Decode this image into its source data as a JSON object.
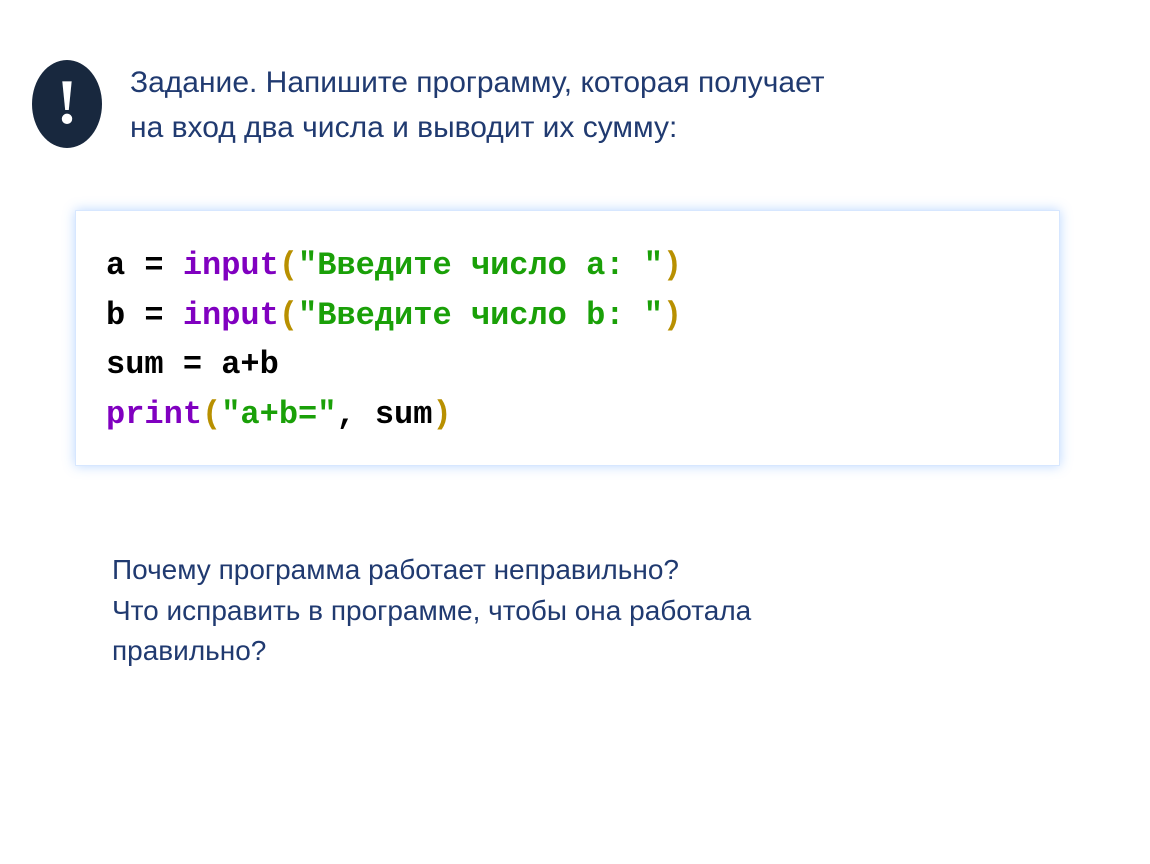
{
  "badge": {
    "mark": "!"
  },
  "task": {
    "line1": "Задание. Напишите программу, которая получает",
    "line2": "на вход два числа и выводит их сумму:"
  },
  "code": {
    "l1": {
      "a": "a = ",
      "fn": "input",
      "p1": "(",
      "s": "\"Введите число a: \"",
      "p2": ")"
    },
    "l2": {
      "a": "b = ",
      "fn": "input",
      "p1": "(",
      "s": "\"Введите число b: \"",
      "p2": ")"
    },
    "l3": {
      "a": "sum = a+b"
    },
    "l4": {
      "fn": "print",
      "p1": "(",
      "s": "\"a+b=\"",
      "c": ", sum",
      "p2": ")"
    }
  },
  "questions": {
    "q1": "Почему программа работает неправильно?",
    "q2": "Что исправить в программе, чтобы она работала",
    "q3": "правильно?"
  }
}
